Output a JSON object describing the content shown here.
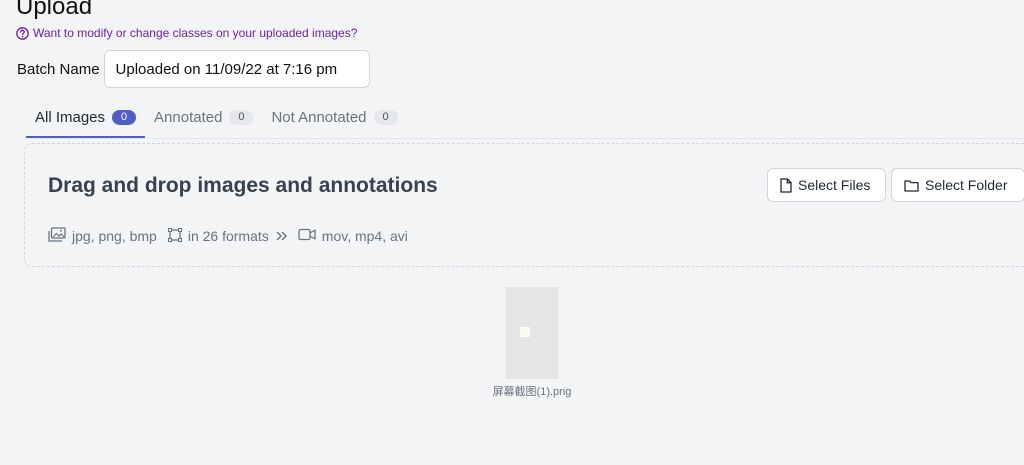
{
  "header": {
    "title": "Upload",
    "help_link": "Want to modify or change classes on your uploaded images?"
  },
  "batch": {
    "label": "Batch Name",
    "value": "Uploaded on 11/09/22 at 7:16 pm"
  },
  "tabs": [
    {
      "label": "All Images",
      "count": "0",
      "active": true
    },
    {
      "label": "Annotated",
      "count": "0",
      "active": false
    },
    {
      "label": "Not Annotated",
      "count": "0",
      "active": false
    }
  ],
  "dropzone": {
    "title": "Drag and drop images and annotations",
    "select_files": "Select Files",
    "select_folder": "Select Folder",
    "image_formats": "jpg, png, bmp",
    "annotation_formats": "in 26 formats",
    "video_formats": "mov, mp4, avi"
  },
  "files": [
    {
      "name": "屏幕截图(1).png"
    }
  ],
  "colors": {
    "accent": "#4f5fc7",
    "link": "#6b21a8",
    "background": "#f3f4f6"
  }
}
